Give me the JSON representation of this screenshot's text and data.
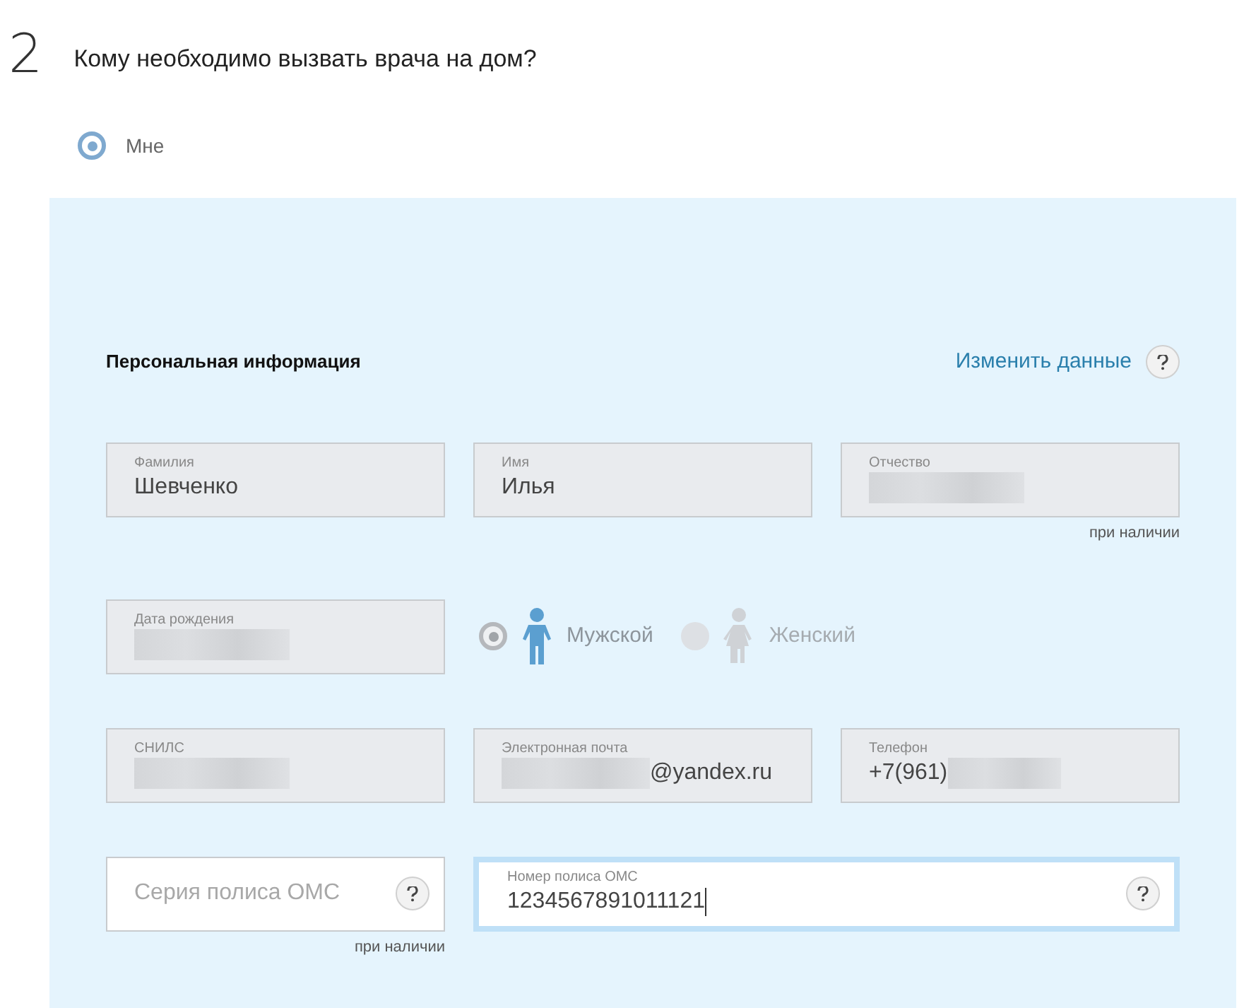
{
  "step": {
    "number": "2",
    "question": "Кому необходимо вызвать врача на дом?"
  },
  "recipients": [
    {
      "label": "Мне",
      "selected": true
    }
  ],
  "section": {
    "title": "Персональная информация",
    "edit_link": "Изменить данные",
    "help": true
  },
  "rows": [
    {
      "fields": [
        {
          "kind": "readonly",
          "label": "Фамилия",
          "value": "Шевченко"
        },
        {
          "kind": "readonly",
          "label": "Имя",
          "value": "Илья"
        },
        {
          "kind": "readonly",
          "label": "Отчество",
          "masked_prefix": true,
          "note": "при наличии"
        }
      ]
    },
    {
      "fields": [
        {
          "kind": "readonly",
          "label": "Дата рождения",
          "masked_prefix": true
        },
        {
          "kind": "gender",
          "options": [
            {
              "label": "Мужской",
              "kind": "male",
              "selected": true
            },
            {
              "label": "Женский",
              "kind": "female",
              "selected": false
            }
          ]
        }
      ]
    },
    {
      "fields": [
        {
          "kind": "readonly",
          "label": "СНИЛС",
          "masked_prefix": true
        },
        {
          "kind": "readonly",
          "label": "Электронная почта",
          "value": "@yandex.ru",
          "masked_prefix": true
        },
        {
          "kind": "readonly",
          "label": "Телефон",
          "value": "+7(961)",
          "masked_suffix": true
        }
      ]
    },
    {
      "fields": [
        {
          "kind": "input",
          "placeholder": "Серия полиса ОМС",
          "help": true,
          "focused": false,
          "note": "при наличии"
        },
        {
          "kind": "input",
          "label": "Номер полиса ОМС",
          "value": "1234567891011121",
          "help": true,
          "focused": true,
          "wide": true
        }
      ]
    }
  ]
}
